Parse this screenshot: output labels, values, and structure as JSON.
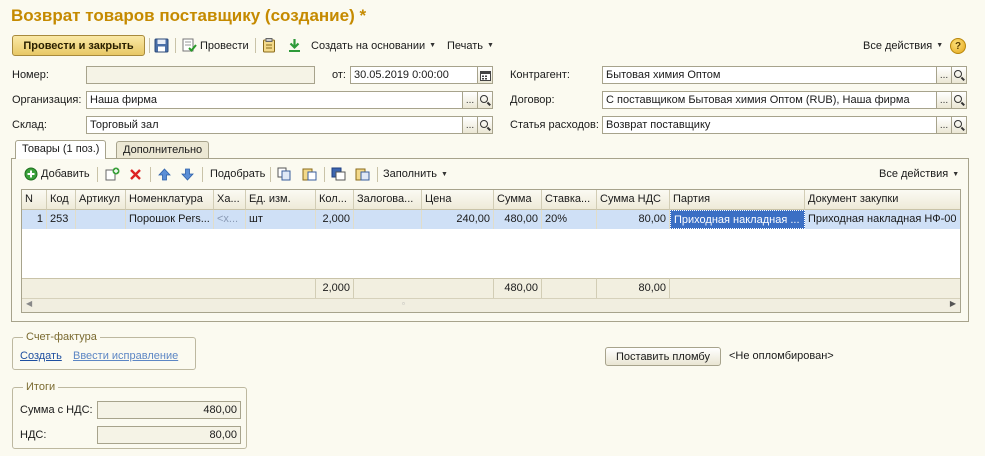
{
  "title": "Возврат товаров поставщику (создание) *",
  "toolbar": {
    "post_close": "Провести и закрыть",
    "post": "Провести",
    "create_based": "Создать на основании",
    "print": "Печать",
    "all_actions": "Все действия",
    "help": "?"
  },
  "form": {
    "number_label": "Номер:",
    "number_value": "",
    "date_label": "от:",
    "date_value": "30.05.2019  0:00:00",
    "org_label": "Организация:",
    "org_value": "Наша фирма",
    "warehouse_label": "Склад:",
    "warehouse_value": "Торговый зал",
    "counterparty_label": "Контрагент:",
    "counterparty_value": "Бытовая химия Оптом",
    "contract_label": "Договор:",
    "contract_value": "С поставщиком Бытовая химия Оптом (RUB), Наша фирма",
    "expense_label": "Статья расходов:",
    "expense_value": "Возврат поставщику",
    "choose_btn": "..."
  },
  "tabs": [
    {
      "label": "Товары (1 поз.)"
    },
    {
      "label": "Дополнительно"
    }
  ],
  "grid_toolbar": {
    "add": "Добавить",
    "pick": "Подобрать",
    "fill": "Заполнить",
    "all_actions": "Все действия"
  },
  "grid": {
    "columns": [
      "N",
      "Код",
      "Артикул",
      "Номенклатура",
      "Ха...",
      "Ед. изм.",
      "Кол...",
      "Залогова...",
      "Цена",
      "Сумма",
      "Ставка...",
      "Сумма НДС",
      "Партия",
      "Документ закупки"
    ],
    "rows": [
      [
        "1",
        "253",
        "",
        "Порошок Pers...",
        "<х...",
        "шт",
        "2,000",
        "",
        "240,00",
        "480,00",
        "20%",
        "80,00",
        "Приходная накладная ...",
        "Приходная накладная НФ-00"
      ]
    ],
    "totals": {
      "quantity": "2,000",
      "sum": "480,00",
      "vat": "80,00"
    }
  },
  "invoice": {
    "title": "Счет-фактура",
    "create": "Создать",
    "correction": "Ввести исправление"
  },
  "seal": {
    "button": "Поставить пломбу",
    "status": "<Не опломбирован>"
  },
  "totals": {
    "title": "Итоги",
    "sum_label": "Сумма с НДС:",
    "sum_value": "480,00",
    "vat_label": "НДС:",
    "vat_value": "80,00"
  },
  "colors": {
    "title": "#c58a00",
    "selection": "#cfe0f6",
    "link": "#1e4fa0"
  }
}
